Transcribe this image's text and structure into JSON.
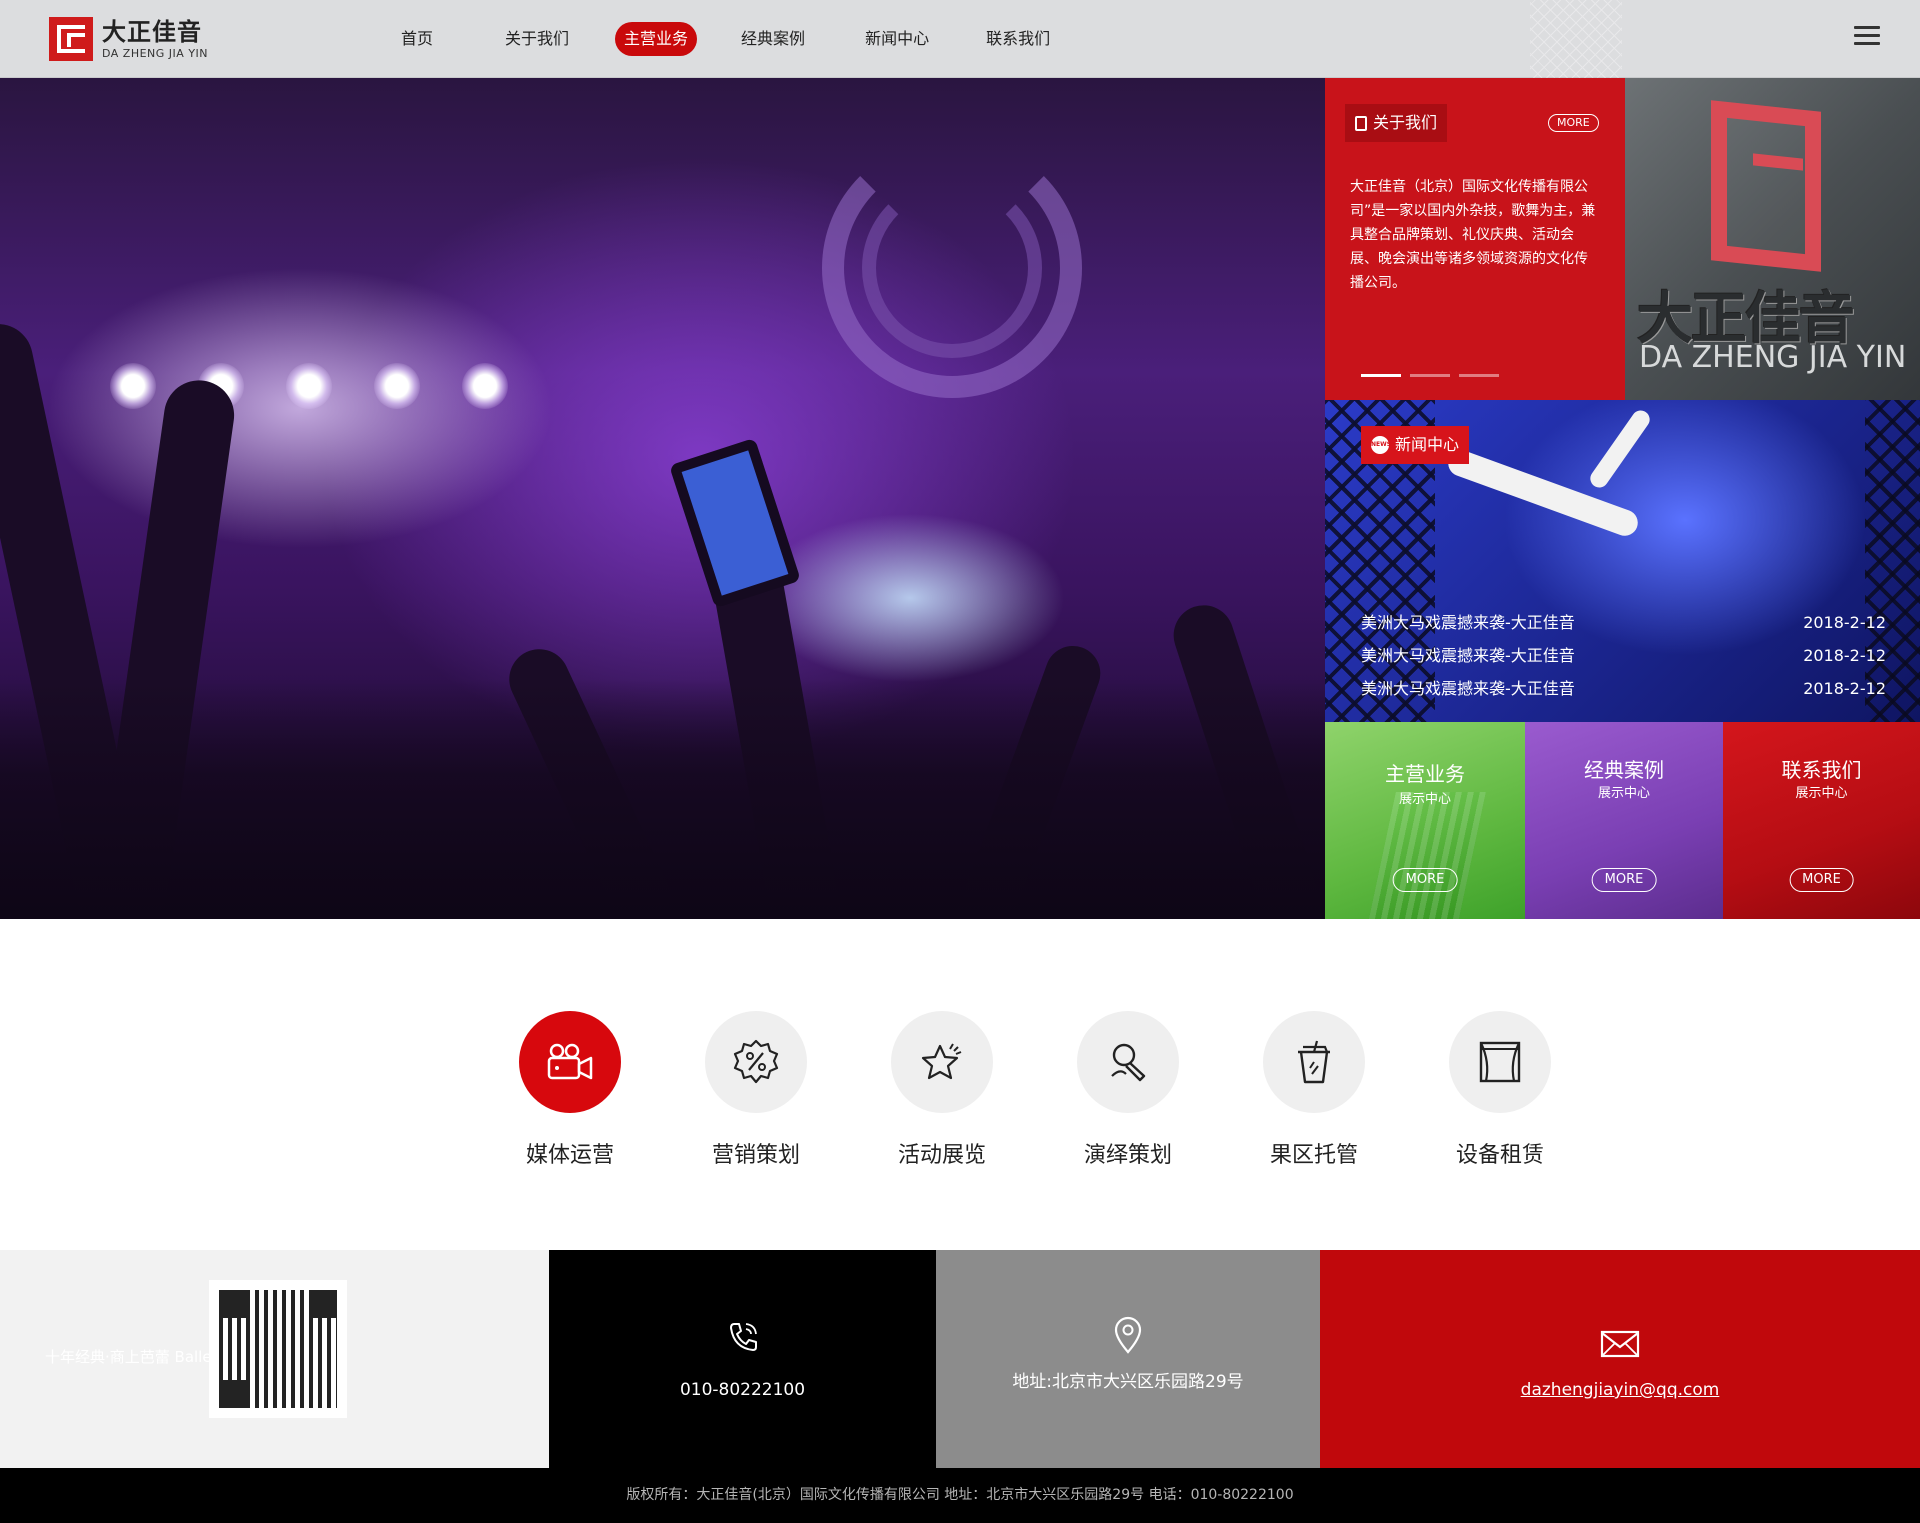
{
  "brand": {
    "name_cn": "大正佳音",
    "name_en": "DA ZHENG JIA YIN"
  },
  "nav": {
    "items": [
      "首页",
      "关于我们",
      "主营业务",
      "经典案例",
      "新闻中心",
      "联系我们"
    ],
    "active_index": 2
  },
  "hero": {
    "slide_count": 5,
    "active_slide": 1
  },
  "about": {
    "tag": "关于我们",
    "more": "MORE",
    "text": "大正佳音（北京）国际文化传播有限公司”是一家以国内外杂技，歌舞为主，兼具整合品牌策划、礼仪庆典、活动会展、晚会演出等诸多领域资源的文化传播公司。"
  },
  "brand_panel": {
    "name_cn": "大正佳音",
    "name_en": "DA ZHENG JIA YIN"
  },
  "news": {
    "tag": "新闻中心",
    "icon_label": "NEWS",
    "items": [
      {
        "title": "美洲大马戏震撼来袭-大正佳音",
        "date": "2018-2-12"
      },
      {
        "title": "美洲大马戏震撼来袭-大正佳音",
        "date": "2018-2-12"
      },
      {
        "title": "美洲大马戏震撼来袭-大正佳音",
        "date": "2018-2-12"
      }
    ]
  },
  "tiles": [
    {
      "title": "主营业务",
      "sub": "展示中心",
      "more": "MORE"
    },
    {
      "title": "经典案例",
      "sub": "展示中心",
      "more": "MORE"
    },
    {
      "title": "联系我们",
      "sub": "展示中心",
      "more": "MORE"
    }
  ],
  "services": [
    {
      "label": "媒体运营",
      "icon": "video-camera-icon"
    },
    {
      "label": "营销策划",
      "icon": "percent-badge-icon"
    },
    {
      "label": "活动展览",
      "icon": "star-icon"
    },
    {
      "label": "演绎策划",
      "icon": "microphone-icon"
    },
    {
      "label": "果区托管",
      "icon": "cup-icon"
    },
    {
      "label": "设备租赁",
      "icon": "stage-curtain-icon"
    }
  ],
  "contact": {
    "tagline": "十年经典·商上芭蕾 Ballet for business",
    "phone": "010-80222100",
    "address": "地址:北京市大兴区乐园路29号",
    "email": "dazhengjiayin@qq.com"
  },
  "footer": {
    "text": "版权所有：大正佳音(北京）国际文化传播有限公司    地址：北京市大兴区乐园路29号  电话：010-80222100"
  },
  "colors": {
    "accent": "#c9090b",
    "header_bg": "#dcdddf",
    "tile_green": "#5fb840",
    "tile_purple": "#7a3fb3"
  }
}
